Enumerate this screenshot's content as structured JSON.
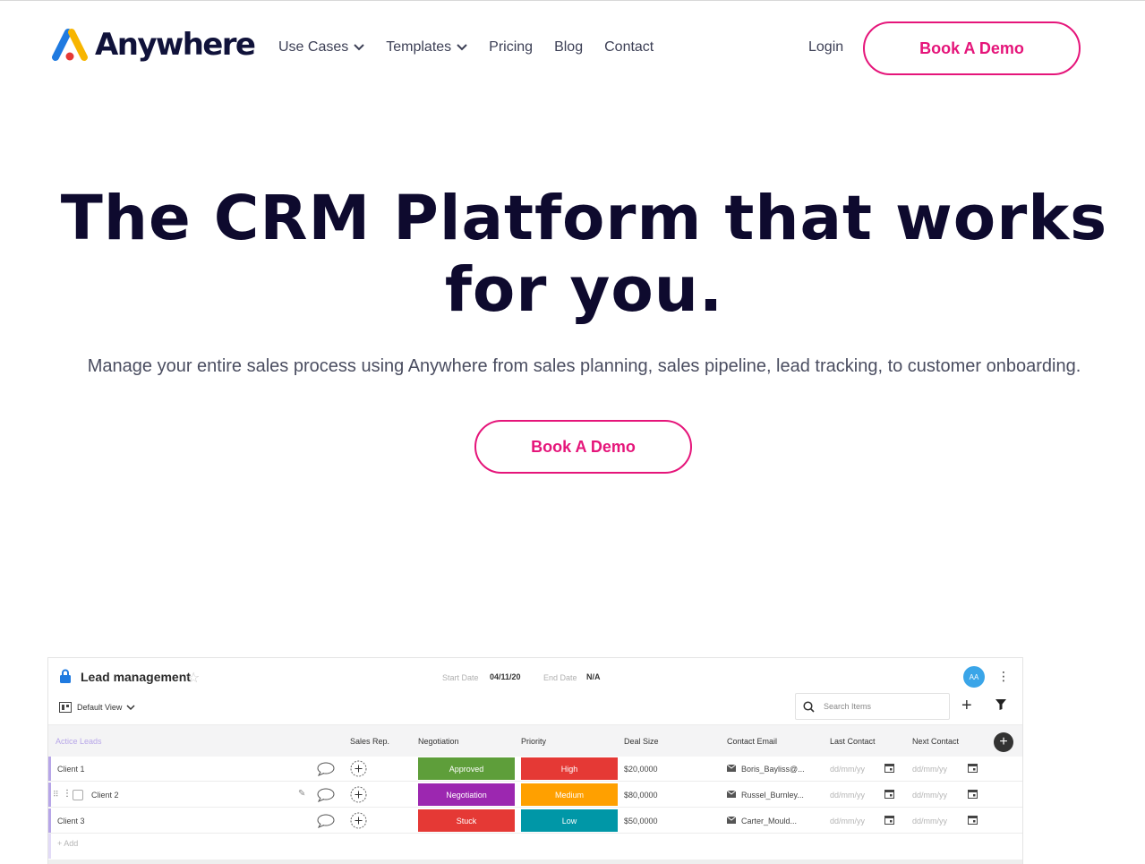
{
  "nav": {
    "logo_text": "Anywhere",
    "menu": [
      {
        "label": "Use Cases",
        "dropdown": true
      },
      {
        "label": "Templates",
        "dropdown": true
      },
      {
        "label": "Pricing",
        "dropdown": false
      },
      {
        "label": "Blog",
        "dropdown": false
      },
      {
        "label": "Contact",
        "dropdown": false
      }
    ],
    "login": "Login",
    "cta": "Book A Demo"
  },
  "hero": {
    "title": "The CRM Platform that works for you.",
    "subtitle": "Manage your entire sales process using Anywhere from sales planning, sales pipeline, lead tracking, to customer onboarding.",
    "cta": "Book A Demo"
  },
  "colors": {
    "accent": "#e5157a",
    "heading": "#0e0a2e",
    "logo_blue": "#1f7ae0",
    "logo_yellow": "#f7b500",
    "logo_red": "#e53935"
  },
  "app": {
    "board_title": "Lead management",
    "start_date_label": "Start Date",
    "start_date": "04/11/20",
    "end_date_label": "End Date",
    "end_date": "N/A",
    "avatar": "AA",
    "view": "Default View",
    "search_placeholder": "Search Items",
    "group": "Actice Leads",
    "columns": [
      "Sales Rep.",
      "Negotiation",
      "Priority",
      "Deal Size",
      "Contact Email",
      "Last Contact",
      "Next Contact"
    ],
    "rows": [
      {
        "name": "Client 1",
        "negotiation": "Approved",
        "negotiation_color": "#5e9e3a",
        "priority": "High",
        "priority_color": "#e53935",
        "deal": "$20,0000",
        "email": "Boris_Bayliss@...",
        "last": "dd/mm/yy",
        "next": "dd/mm/yy"
      },
      {
        "name": "Client 2",
        "negotiation": "Negotiation",
        "negotiation_color": "#9c27b0",
        "priority": "Medium",
        "priority_color": "#ffa000",
        "deal": "$80,0000",
        "email": "Russel_Burnley...",
        "last": "dd/mm/yy",
        "next": "dd/mm/yy"
      },
      {
        "name": "Client 3",
        "negotiation": "Stuck",
        "negotiation_color": "#e53935",
        "priority": "Low",
        "priority_color": "#0097a7",
        "deal": "$50,0000",
        "email": "Carter_Mould...",
        "last": "dd/mm/yy",
        "next": "dd/mm/yy"
      }
    ],
    "add_label": "+ Add"
  }
}
